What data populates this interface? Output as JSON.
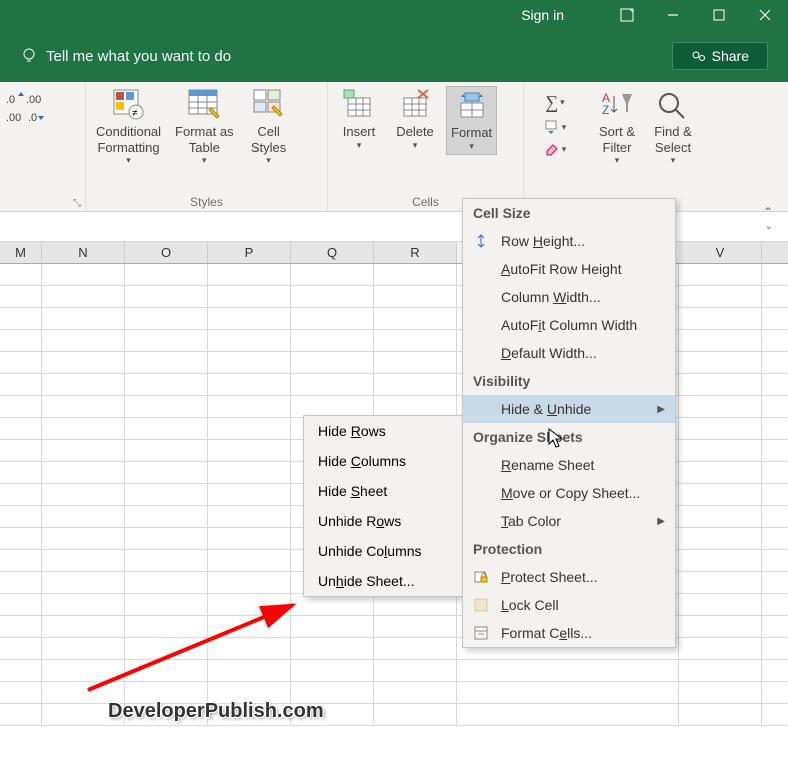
{
  "titlebar": {
    "signin": "Sign in"
  },
  "tellme": {
    "placeholder": "Tell me what you want to do",
    "share": "Share"
  },
  "ribbon": {
    "number_group": "",
    "styles": {
      "label": "Styles",
      "conditional": "Conditional\nFormatting",
      "format_table": "Format as\nTable",
      "cell_styles": "Cell\nStyles"
    },
    "cells": {
      "label": "Cells",
      "insert": "Insert",
      "delete": "Delete",
      "format": "Format"
    },
    "editing": {
      "sort_filter": "Sort &\nFilter",
      "find_select": "Find &\nSelect"
    }
  },
  "columns": {
    "c0": "M",
    "c1": "N",
    "c2": "O",
    "c3": "P",
    "c4": "Q",
    "c5": "R",
    "c6": "",
    "c7": "",
    "c8": "V"
  },
  "format_menu": {
    "s1": "Cell Size",
    "row_height": "Row Height...",
    "autofit_row": "AutoFit Row Height",
    "col_width": "Column Width...",
    "autofit_col": "AutoFit Column Width",
    "default_width": "Default Width...",
    "s2": "Visibility",
    "hide_unhide": "Hide & Unhide",
    "s3": "Organize Sheets",
    "rename": "Rename Sheet",
    "move_copy": "Move or Copy Sheet...",
    "tab_color": "Tab Color",
    "s4": "Protection",
    "protect": "Protect Sheet...",
    "lock": "Lock Cell",
    "format_cells": "Format Cells..."
  },
  "submenu": {
    "hide_rows": "Hide Rows",
    "hide_cols": "Hide Columns",
    "hide_sheet": "Hide Sheet",
    "unhide_rows": "Unhide Rows",
    "unhide_cols": "Unhide Columns",
    "unhide_sheet": "Unhide Sheet..."
  },
  "watermark": "DeveloperPublish.com"
}
